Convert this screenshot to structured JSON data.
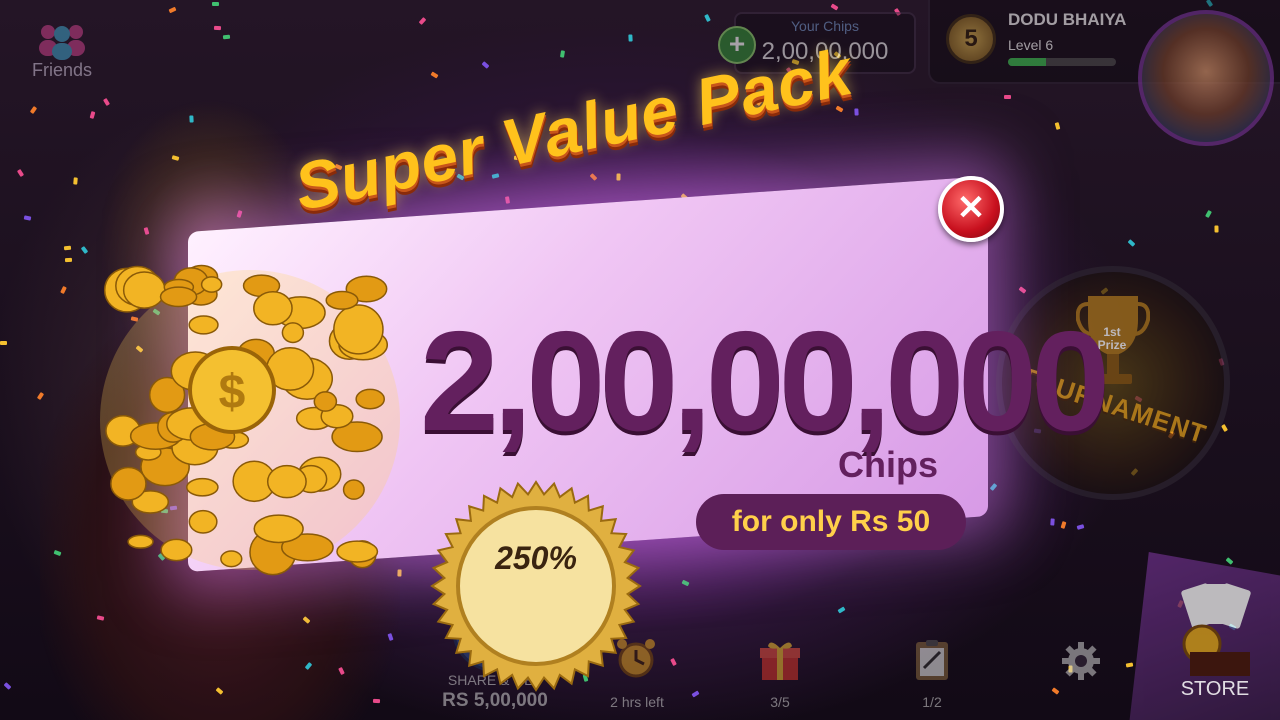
{
  "friends": {
    "label": "Friends"
  },
  "chips": {
    "caption": "Your Chips",
    "value": "2,00,00,000"
  },
  "player": {
    "name": "DODU BHAIYA",
    "level_text": "Level 6",
    "level": "5",
    "xp_fraction": 0.35
  },
  "tournament": {
    "label": "TOURNAMENT",
    "prize": "1st Prize"
  },
  "popup": {
    "title": "Super Value Pack",
    "amount": "2,00,00,000",
    "unit": "Chips",
    "price": "for only Rs 50",
    "badge": "250%"
  },
  "bottom_bar": {
    "share_label": "SHARE & GET",
    "share_value": "RS 5,00,000",
    "timer": "2 hrs left",
    "gifts": "3/5",
    "tasks": "1/2"
  },
  "store": {
    "label": "STORE"
  },
  "colors": {
    "accent": "#6a2f86",
    "gold": "#ffc21c",
    "amount": "#63205e",
    "close": "#c8101e"
  }
}
